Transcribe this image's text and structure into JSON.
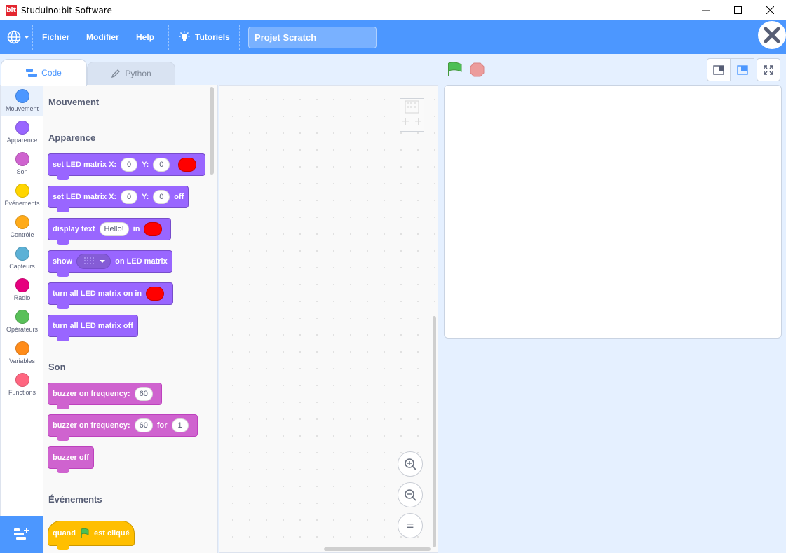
{
  "window": {
    "title": "Studuino:bit Software",
    "logo_text": "bit"
  },
  "menu": {
    "file": "Fichier",
    "edit": "Modifier",
    "help": "Help",
    "tutorials": "Tutoriels",
    "project_title": "Projet Scratch"
  },
  "tabs": {
    "code": "Code",
    "python": "Python"
  },
  "categories": [
    {
      "label": "Mouvement",
      "color": "#4c97ff"
    },
    {
      "label": "Apparence",
      "color": "#9966ff"
    },
    {
      "label": "Son",
      "color": "#cf63cf"
    },
    {
      "label": "Événements",
      "color": "#ffd500"
    },
    {
      "label": "Contrôle",
      "color": "#ffab19"
    },
    {
      "label": "Capteurs",
      "color": "#5cb1d6"
    },
    {
      "label": "Radio",
      "color": "#e6007e"
    },
    {
      "label": "Opérateurs",
      "color": "#59c059"
    },
    {
      "label": "Variables",
      "color": "#ff8c1a"
    },
    {
      "label": "Functions",
      "color": "#ff6680"
    }
  ],
  "palette": {
    "sections": {
      "motion": "Mouvement",
      "looks": "Apparence",
      "sound": "Son",
      "events": "Événements"
    },
    "blocks": {
      "led_on": {
        "label": "set LED matrix X:",
        "x": "0",
        "y_label": "Y:",
        "y": "0"
      },
      "led_off": {
        "label": "set LED matrix X:",
        "x": "0",
        "y_label": "Y:",
        "y": "0",
        "suffix": "off"
      },
      "display_text": {
        "label": "display text",
        "text": "Hello!",
        "in": "in"
      },
      "show": {
        "label": "show",
        "suffix": "on LED matrix"
      },
      "all_on": {
        "label": "turn all LED matrix on in"
      },
      "all_off": {
        "label": "turn all LED matrix off"
      },
      "buzzer_on": {
        "label": "buzzer on frequency:",
        "value": "60"
      },
      "buzzer_for": {
        "label": "buzzer on frequency:",
        "value": "60",
        "for": "for",
        "duration": "1"
      },
      "buzzer_off": {
        "label": "buzzer off"
      },
      "when_flag": {
        "label": "quand",
        "suffix": "est cliqué"
      }
    }
  },
  "zoom": {
    "reset": "="
  },
  "colors": {
    "accent": "#4c97ff",
    "looks": "#9966ff",
    "sound": "#cf63cf",
    "events": "#ffbf00",
    "led": "#ff0000"
  }
}
